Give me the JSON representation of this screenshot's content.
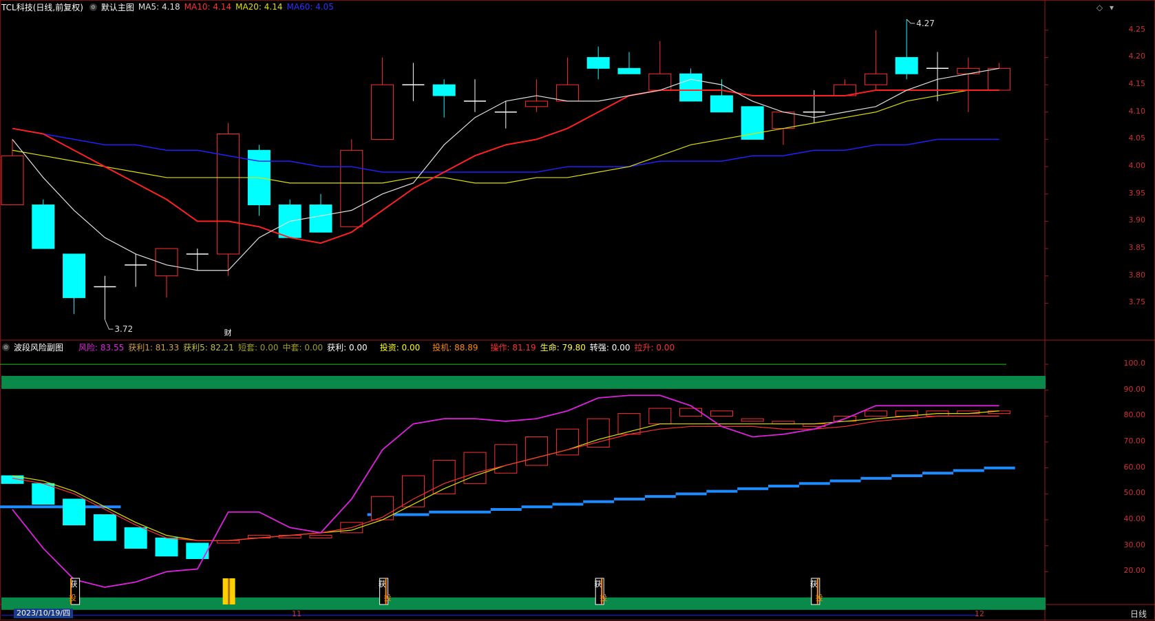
{
  "header_main": {
    "symbol": "TCL科技(日线,前复权)",
    "chart_name": "默认主图",
    "ma5": "MA5: 4.18",
    "ma10": "MA10: 4.14",
    "ma20": "MA20: 4.14",
    "ma60": "MA60: 4.05"
  },
  "header_sub": {
    "name": "波段风险副图",
    "items": [
      {
        "text": "风险: 83.55",
        "color": "#e020e0"
      },
      {
        "text": "获利1: 81.33",
        "color": "#d0a040"
      },
      {
        "text": "获利5: 82.21",
        "color": "#c0c040"
      },
      {
        "text": "短套: 0.00",
        "color": "#a0a020"
      },
      {
        "text": "中套: 0.00",
        "color": "#a0a020"
      },
      {
        "text": "获利: 0.00",
        "color": "#ffffff"
      },
      {
        "text": "投资: 0.00",
        "color": "#ffff00"
      },
      {
        "text": "投机: 88.89",
        "color": "#ff8c00"
      },
      {
        "text": "操作: 81.19",
        "color": "#ff3030"
      },
      {
        "text": "生命: 79.80",
        "color": "#ffff40"
      },
      {
        "text": "转强: 0.00",
        "color": "#ffffff"
      },
      {
        "text": "拉升: 0.00",
        "color": "#ff3030"
      }
    ]
  },
  "price_axis": [
    "4.25",
    "4.20",
    "4.15",
    "4.10",
    "4.05",
    "4.00",
    "3.95",
    "3.90",
    "3.85",
    "3.80",
    "3.75"
  ],
  "sub_axis": [
    "100.0",
    "90.00",
    "80.00",
    "70.00",
    "60.00",
    "50.00",
    "40.00",
    "30.00",
    "20.00"
  ],
  "annotations": {
    "high": "4.27",
    "low": "3.72",
    "fin_marker": "财"
  },
  "x_axis": {
    "date": "2023/10/19/四",
    "month_11": "11",
    "month_12": "12"
  },
  "period_tab": "日线",
  "signal_labels": {
    "buy": "投",
    "profit": "获"
  },
  "colors": {
    "up": "#ff3030",
    "down": "#00ffff",
    "ma5": "#e0e0e0",
    "ma10": "#ff2020",
    "ma20": "#e0e000",
    "ma60": "#2020ff",
    "risk": "#e020e0",
    "green_band": "#0a8a4a"
  },
  "chart_data": {
    "type": "candlestick",
    "candles": [
      {
        "o": 3.93,
        "h": 4.05,
        "l": 3.93,
        "c": 4.02
      },
      {
        "o": 3.93,
        "h": 3.94,
        "l": 3.85,
        "c": 3.85
      },
      {
        "o": 3.84,
        "h": 3.84,
        "l": 3.73,
        "c": 3.76
      },
      {
        "o": 3.78,
        "h": 3.8,
        "l": 3.72,
        "c": 3.78
      },
      {
        "o": 3.82,
        "h": 3.84,
        "l": 3.78,
        "c": 3.82
      },
      {
        "o": 3.8,
        "h": 3.85,
        "l": 3.76,
        "c": 3.85
      },
      {
        "o": 3.84,
        "h": 3.85,
        "l": 3.81,
        "c": 3.84
      },
      {
        "o": 3.84,
        "h": 4.08,
        "l": 3.8,
        "c": 4.06
      },
      {
        "o": 4.03,
        "h": 4.04,
        "l": 3.91,
        "c": 3.93
      },
      {
        "o": 3.93,
        "h": 3.94,
        "l": 3.87,
        "c": 3.87
      },
      {
        "o": 3.93,
        "h": 3.95,
        "l": 3.88,
        "c": 3.88
      },
      {
        "o": 3.89,
        "h": 4.05,
        "l": 3.89,
        "c": 4.03
      },
      {
        "o": 4.05,
        "h": 4.2,
        "l": 4.05,
        "c": 4.15
      },
      {
        "o": 4.15,
        "h": 4.19,
        "l": 4.12,
        "c": 4.15
      },
      {
        "o": 4.15,
        "h": 4.16,
        "l": 4.09,
        "c": 4.13
      },
      {
        "o": 4.12,
        "h": 4.16,
        "l": 4.1,
        "c": 4.12
      },
      {
        "o": 4.1,
        "h": 4.12,
        "l": 4.07,
        "c": 4.1
      },
      {
        "o": 4.11,
        "h": 4.16,
        "l": 4.1,
        "c": 4.12
      },
      {
        "o": 4.12,
        "h": 4.2,
        "l": 4.12,
        "c": 4.15
      },
      {
        "o": 4.2,
        "h": 4.22,
        "l": 4.16,
        "c": 4.18
      },
      {
        "o": 4.18,
        "h": 4.21,
        "l": 4.17,
        "c": 4.17
      },
      {
        "o": 4.14,
        "h": 4.23,
        "l": 4.14,
        "c": 4.17
      },
      {
        "o": 4.17,
        "h": 4.18,
        "l": 4.12,
        "c": 4.12
      },
      {
        "o": 4.13,
        "h": 4.16,
        "l": 4.1,
        "c": 4.1
      },
      {
        "o": 4.11,
        "h": 4.11,
        "l": 4.05,
        "c": 4.05
      },
      {
        "o": 4.07,
        "h": 4.1,
        "l": 4.04,
        "c": 4.1
      },
      {
        "o": 4.1,
        "h": 4.14,
        "l": 4.08,
        "c": 4.1
      },
      {
        "o": 4.13,
        "h": 4.16,
        "l": 4.13,
        "c": 4.15
      },
      {
        "o": 4.15,
        "h": 4.25,
        "l": 4.14,
        "c": 4.17
      },
      {
        "o": 4.2,
        "h": 4.27,
        "l": 4.16,
        "c": 4.17
      },
      {
        "o": 4.18,
        "h": 4.21,
        "l": 4.12,
        "c": 4.18
      },
      {
        "o": 4.17,
        "h": 4.2,
        "l": 4.1,
        "c": 4.18
      },
      {
        "o": 4.14,
        "h": 4.19,
        "l": 4.14,
        "c": 4.18
      }
    ],
    "ma5": [
      4.05,
      3.98,
      3.92,
      3.87,
      3.84,
      3.82,
      3.81,
      3.81,
      3.87,
      3.9,
      3.91,
      3.92,
      3.95,
      3.97,
      4.04,
      4.09,
      4.12,
      4.13,
      4.12,
      4.12,
      4.13,
      4.14,
      4.16,
      4.15,
      4.12,
      4.1,
      4.09,
      4.1,
      4.11,
      4.14,
      4.16,
      4.17,
      4.18
    ],
    "ma10": [
      4.07,
      4.06,
      4.03,
      4.0,
      3.97,
      3.94,
      3.9,
      3.9,
      3.89,
      3.87,
      3.86,
      3.88,
      3.92,
      3.96,
      3.99,
      4.02,
      4.04,
      4.05,
      4.07,
      4.1,
      4.13,
      4.14,
      4.14,
      4.14,
      4.13,
      4.13,
      4.13,
      4.13,
      4.14,
      4.14,
      4.14,
      4.14,
      4.14
    ],
    "ma20": [
      4.03,
      4.02,
      4.01,
      4.0,
      3.99,
      3.98,
      3.98,
      3.98,
      3.98,
      3.97,
      3.97,
      3.97,
      3.97,
      3.98,
      3.98,
      3.97,
      3.97,
      3.98,
      3.98,
      3.99,
      4.0,
      4.02,
      4.04,
      4.05,
      4.06,
      4.07,
      4.08,
      4.09,
      4.1,
      4.12,
      4.13,
      4.14,
      4.14
    ],
    "ma60": [
      4.07,
      4.06,
      4.05,
      4.04,
      4.04,
      4.03,
      4.03,
      4.02,
      4.01,
      4.01,
      4.0,
      4.0,
      3.99,
      3.99,
      3.99,
      3.99,
      3.99,
      3.99,
      4.0,
      4.0,
      4.0,
      4.01,
      4.01,
      4.01,
      4.02,
      4.02,
      4.03,
      4.03,
      4.04,
      4.04,
      4.05,
      4.05,
      4.05
    ],
    "sub": {
      "bars": [
        {
          "o": 57,
          "c": 54
        },
        {
          "o": 54,
          "c": 46
        },
        {
          "o": 48,
          "c": 38
        },
        {
          "o": 42,
          "c": 32
        },
        {
          "o": 37,
          "c": 29
        },
        {
          "o": 33,
          "c": 26
        },
        {
          "o": 31,
          "c": 25
        },
        {
          "o": 31,
          "c": 32
        },
        {
          "o": 33,
          "c": 34
        },
        {
          "o": 33,
          "c": 34
        },
        {
          "o": 33,
          "c": 34
        },
        {
          "o": 35,
          "c": 39
        },
        {
          "o": 40,
          "c": 49
        },
        {
          "o": 45,
          "c": 57
        },
        {
          "o": 50,
          "c": 63
        },
        {
          "o": 54,
          "c": 66
        },
        {
          "o": 58,
          "c": 69
        },
        {
          "o": 61,
          "c": 72
        },
        {
          "o": 65,
          "c": 75
        },
        {
          "o": 68,
          "c": 79
        },
        {
          "o": 73,
          "c": 81
        },
        {
          "o": 77,
          "c": 83
        },
        {
          "o": 80,
          "c": 83
        },
        {
          "o": 80,
          "c": 82
        },
        {
          "o": 78,
          "c": 79
        },
        {
          "o": 77,
          "c": 78
        },
        {
          "o": 76,
          "c": 77
        },
        {
          "o": 78,
          "c": 80
        },
        {
          "o": 80,
          "c": 82
        },
        {
          "o": 80,
          "c": 82
        },
        {
          "o": 80,
          "c": 82
        },
        {
          "o": 81,
          "c": 82
        },
        {
          "o": 81,
          "c": 82
        }
      ],
      "risk": [
        44,
        29,
        17,
        14,
        16,
        20,
        21,
        43,
        43,
        37,
        35,
        48,
        67,
        77,
        79,
        79,
        78,
        79,
        82,
        87,
        88,
        88,
        84,
        76,
        72,
        73,
        75,
        79,
        84,
        84,
        84,
        84,
        84
      ],
      "profit1": [
        56,
        54,
        50,
        44,
        38,
        33,
        32,
        32,
        33,
        34,
        35,
        37,
        41,
        48,
        54,
        58,
        61,
        64,
        67,
        70,
        73,
        75,
        76,
        76,
        76,
        75,
        75,
        76,
        78,
        79,
        80,
        80,
        80
      ],
      "profit5": [
        57,
        55,
        51,
        45,
        39,
        34,
        32,
        32,
        33,
        34,
        35,
        36,
        40,
        46,
        52,
        57,
        61,
        64,
        67,
        71,
        74,
        77,
        77,
        77,
        77,
        77,
        77,
        78,
        79,
        80,
        81,
        81,
        82
      ],
      "investment_line": [
        45,
        45,
        45,
        45,
        null,
        null,
        null,
        null,
        null,
        null,
        null,
        null,
        42,
        42,
        43,
        43,
        44,
        45,
        46,
        47,
        48,
        49,
        50,
        51,
        52,
        53,
        54,
        55,
        56,
        57,
        58,
        59,
        60
      ]
    }
  }
}
